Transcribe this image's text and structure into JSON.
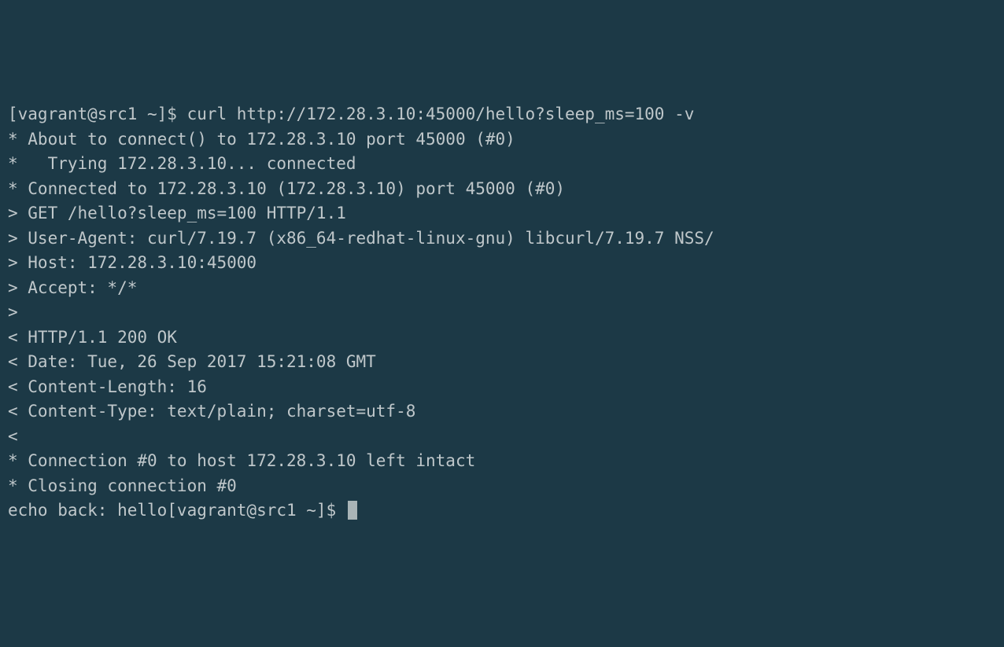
{
  "terminal": {
    "lines": [
      "[vagrant@src1 ~]$ curl http://172.28.3.10:45000/hello?sleep_ms=100 -v",
      "* About to connect() to 172.28.3.10 port 45000 (#0)",
      "*   Trying 172.28.3.10... connected",
      "* Connected to 172.28.3.10 (172.28.3.10) port 45000 (#0)",
      "> GET /hello?sleep_ms=100 HTTP/1.1",
      "> User-Agent: curl/7.19.7 (x86_64-redhat-linux-gnu) libcurl/7.19.7 NSS/",
      "> Host: 172.28.3.10:45000",
      "> Accept: */*",
      ">",
      "< HTTP/1.1 200 OK",
      "< Date: Tue, 26 Sep 2017 15:21:08 GMT",
      "< Content-Length: 16",
      "< Content-Type: text/plain; charset=utf-8",
      "<",
      "* Connection #0 to host 172.28.3.10 left intact",
      "* Closing connection #0",
      "echo back: hello[vagrant@src1 ~]$ "
    ]
  }
}
